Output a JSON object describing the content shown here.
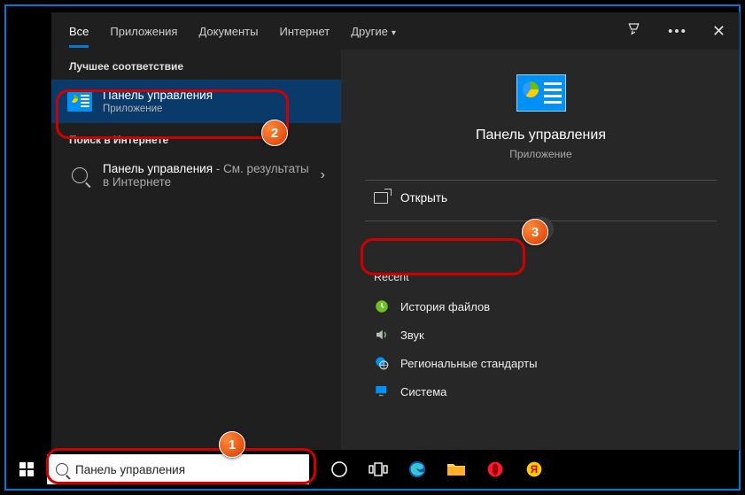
{
  "tabs": {
    "all": "Все",
    "apps": "Приложения",
    "docs": "Документы",
    "web": "Интернет",
    "more": "Другие"
  },
  "sections": {
    "best_match": "Лучшее соответствие",
    "search_web": "Поиск в Интернете"
  },
  "best_match": {
    "title": "Панель управления",
    "subtitle": "Приложение"
  },
  "web_result": {
    "prefix": "Панель управления",
    "suffix": " - См. результаты в Интернете"
  },
  "detail": {
    "title": "Панель управления",
    "subtitle": "Приложение",
    "open_label": "Открыть",
    "recent_label": "Recent",
    "recent_items": [
      {
        "icon": "history",
        "label": "История файлов"
      },
      {
        "icon": "sound",
        "label": "Звук"
      },
      {
        "icon": "region",
        "label": "Региональные стандарты"
      },
      {
        "icon": "system",
        "label": "Система"
      }
    ]
  },
  "search": {
    "query": "Панель управления"
  },
  "annotations": [
    {
      "num": "1"
    },
    {
      "num": "2"
    },
    {
      "num": "3"
    }
  ]
}
